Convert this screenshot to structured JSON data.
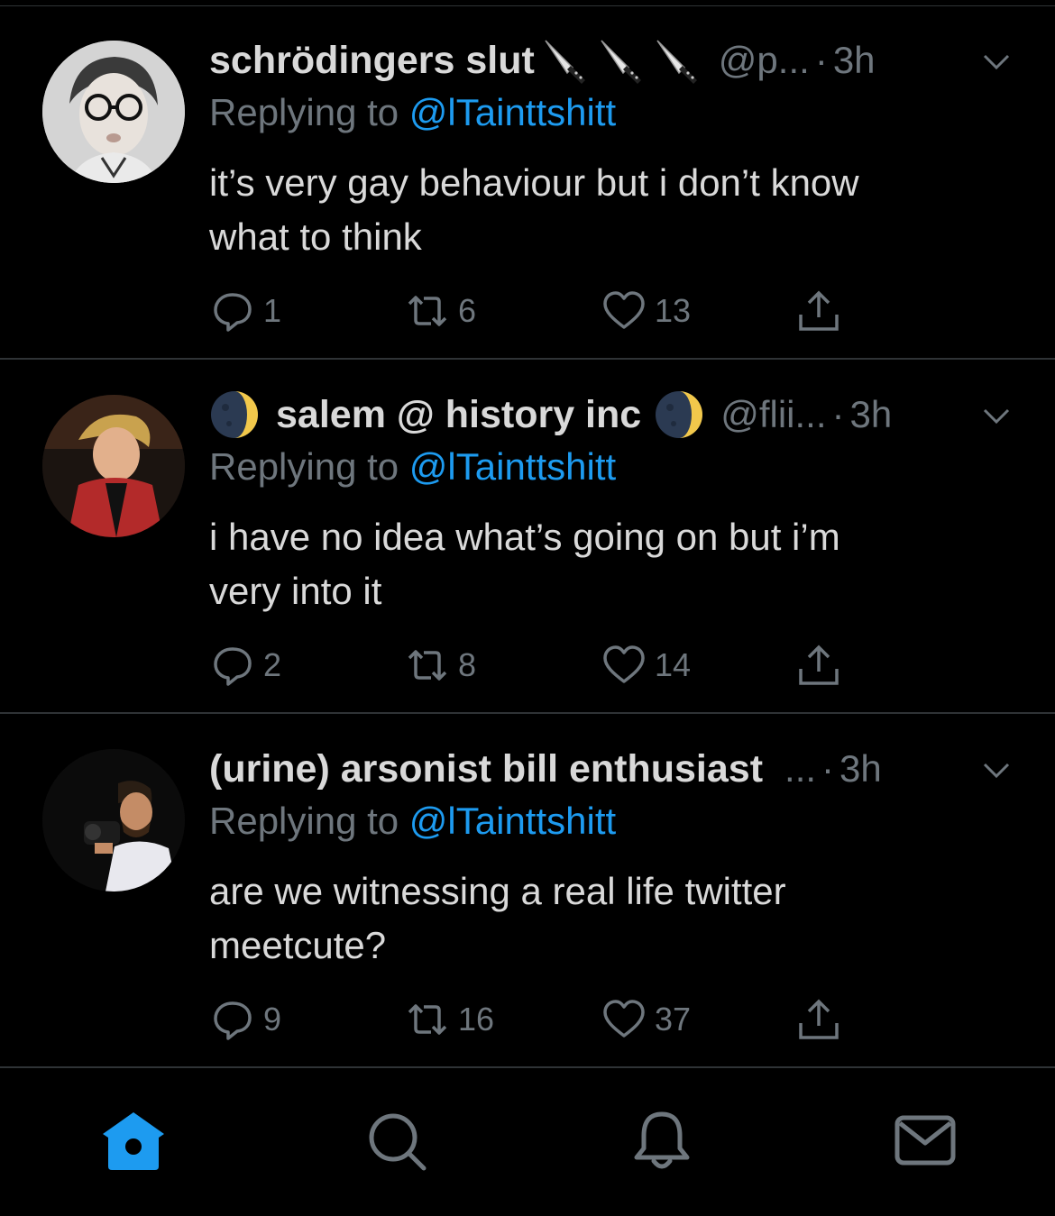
{
  "tweets": [
    {
      "name": "schrödingers slut",
      "emoji_icons": [
        "knife-icon",
        "knife-icon",
        "knife-icon"
      ],
      "handle": "@p...",
      "dot": "·",
      "time": "3h",
      "replying_prefix": "Replying to",
      "replying_to": "@lTainttshitt",
      "text_line1": "it’s very gay behaviour but i don’t know",
      "text_line2": "what to think",
      "replies": "1",
      "retweets": "6",
      "likes": "13"
    },
    {
      "name": "salem @ history inc",
      "emoji_icons": [
        "moon-icon",
        "moon-icon"
      ],
      "handle": "@flii...",
      "dot": "·",
      "time": "3h",
      "replying_prefix": "Replying to",
      "replying_to": "@lTainttshitt",
      "text_line1": "i have no idea what’s going on but i’m",
      "text_line2": "very into it",
      "replies": "2",
      "retweets": "8",
      "likes": "14"
    },
    {
      "name": "(urine) arsonist bill enthusiast",
      "handle": "...",
      "dot": "·",
      "time": "3h",
      "replying_prefix": "Replying to",
      "replying_to": "@lTainttshitt",
      "text_line1": "are we witnessing a real life twitter",
      "text_line2": "meetcute?",
      "replies": "9",
      "retweets": "16",
      "likes": "37"
    }
  ],
  "tabbar": {
    "icons": [
      "home-icon",
      "search-icon",
      "notifications-icon",
      "messages-icon"
    ],
    "active": "home",
    "accent": "#1d9bf0"
  },
  "colors": {
    "background": "#000000",
    "text": "#d9d9d9",
    "muted": "#6e767d",
    "link": "#1d9bf0",
    "divider": "#2f3336"
  }
}
